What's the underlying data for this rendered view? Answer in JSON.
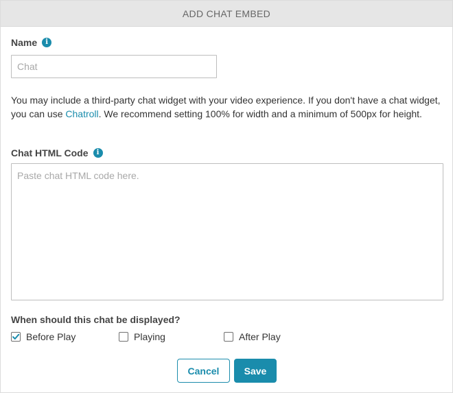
{
  "header": {
    "title": "ADD CHAT EMBED"
  },
  "name_field": {
    "label": "Name",
    "info_icon": "info-icon",
    "value": "",
    "placeholder": "Chat"
  },
  "description": {
    "before_link": "You may include a third-party chat widget with your video experience. If you don't have a chat widget, you can use ",
    "link_text": "Chatroll",
    "after_link": ". We recommend setting 100% for width and a minimum of 500px for height."
  },
  "code_field": {
    "label": "Chat HTML Code",
    "info_icon": "info-icon",
    "value": "",
    "placeholder": "Paste chat HTML code here."
  },
  "display_options": {
    "label": "When should this chat be displayed?",
    "options": [
      {
        "label": "Before Play",
        "checked": true
      },
      {
        "label": "Playing",
        "checked": false
      },
      {
        "label": "After Play",
        "checked": false
      }
    ]
  },
  "buttons": {
    "cancel": "Cancel",
    "save": "Save"
  },
  "colors": {
    "accent": "#1a8cac",
    "header_bg": "#e6e6e6",
    "placeholder": "#a8a8a8"
  }
}
